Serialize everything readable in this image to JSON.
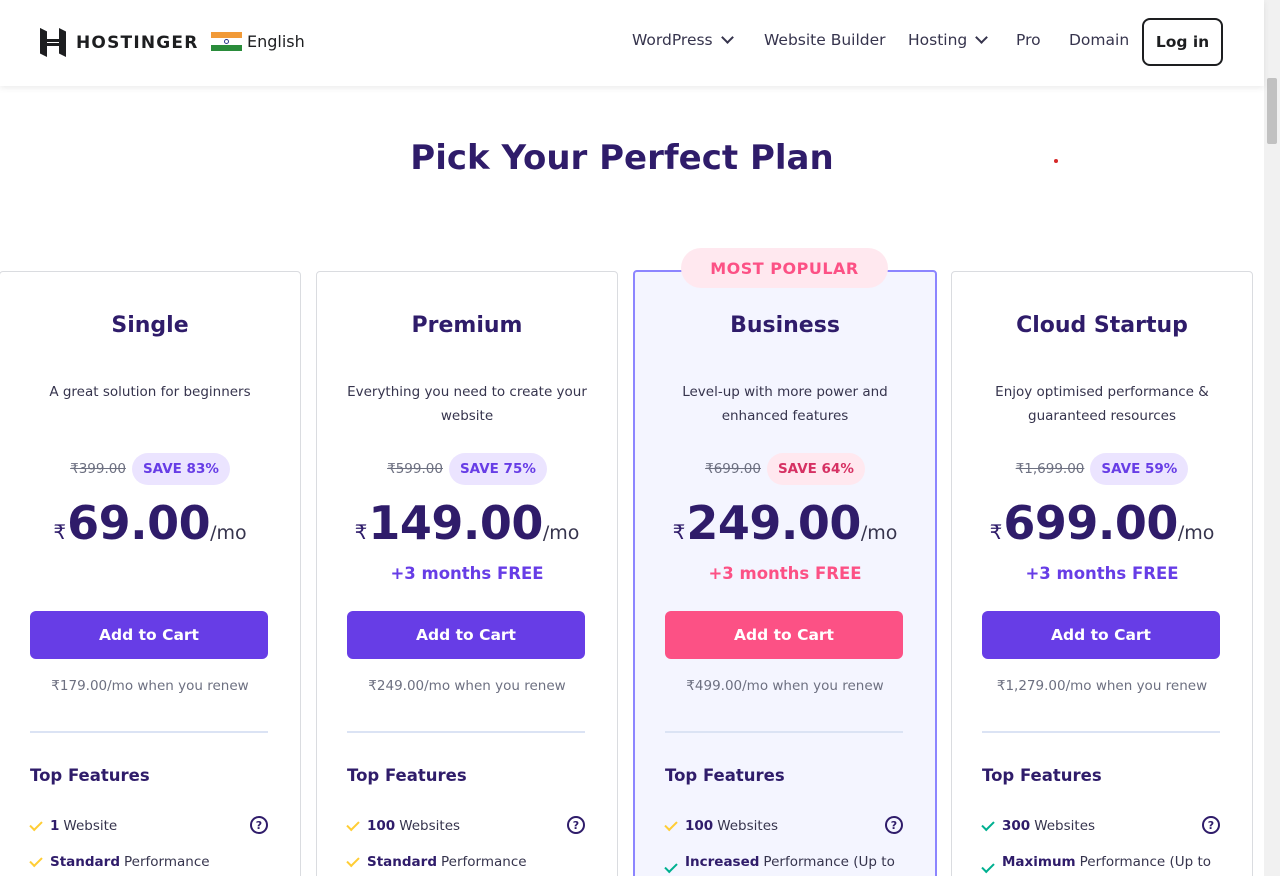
{
  "header": {
    "brand": "HOSTINGER",
    "language": "English",
    "nav": [
      {
        "label": "WordPress",
        "dropdown": true
      },
      {
        "label": "Website Builder",
        "dropdown": false
      },
      {
        "label": "Hosting",
        "dropdown": true
      },
      {
        "label": "Pro",
        "dropdown": false
      },
      {
        "label": "Domain",
        "dropdown": false
      }
    ],
    "login": "Log in"
  },
  "title": "Pick Your Perfect Plan",
  "popular_badge": "MOST POPULAR",
  "plans": [
    {
      "name": "Single",
      "description": "A great solution for beginners",
      "old_price": "₹399.00",
      "save": "SAVE 83%",
      "currency": "₹",
      "price": "69.00",
      "per": "/mo",
      "bonus": "",
      "cta": "Add to Cart",
      "renew": "₹179.00/mo when you renew",
      "features_title": "Top Features",
      "features": [
        {
          "bold": "1",
          "text": "Website"
        },
        {
          "bold": "Standard",
          "text": "Performance"
        }
      ]
    },
    {
      "name": "Premium",
      "description": "Everything you need to create your website",
      "old_price": "₹599.00",
      "save": "SAVE 75%",
      "currency": "₹",
      "price": "149.00",
      "per": "/mo",
      "bonus": "+3 months FREE",
      "cta": "Add to Cart",
      "renew": "₹249.00/mo when you renew",
      "features_title": "Top Features",
      "features": [
        {
          "bold": "100",
          "text": "Websites"
        },
        {
          "bold": "Standard",
          "text": "Performance"
        }
      ]
    },
    {
      "name": "Business",
      "description": "Level-up with more power and enhanced features",
      "old_price": "₹699.00",
      "save": "SAVE 64%",
      "currency": "₹",
      "price": "249.00",
      "per": "/mo",
      "bonus": "+3 months FREE",
      "cta": "Add to Cart",
      "renew": "₹499.00/mo when you renew",
      "features_title": "Top Features",
      "features": [
        {
          "bold": "100",
          "text": "Websites"
        },
        {
          "bold": "Increased",
          "text": "Performance (Up to"
        }
      ]
    },
    {
      "name": "Cloud Startup",
      "description": "Enjoy optimised performance & guaranteed resources",
      "old_price": "₹1,699.00",
      "save": "SAVE 59%",
      "currency": "₹",
      "price": "699.00",
      "per": "/mo",
      "bonus": "+3 months FREE",
      "cta": "Add to Cart",
      "renew": "₹1,279.00/mo when you renew",
      "features_title": "Top Features",
      "features": [
        {
          "bold": "300",
          "text": "Websites"
        },
        {
          "bold": "Maximum",
          "text": "Performance (Up to"
        }
      ]
    }
  ],
  "colors": {
    "accent": "#673de6",
    "highlight": "#fc5185",
    "heading": "#2f1c6a",
    "check_yellow": "#ffcd35",
    "check_green": "#00b090"
  },
  "icons": {
    "logo": "hostinger-logo-icon",
    "flag": "india-flag-icon",
    "dropdown": "chevron-down-icon",
    "check": "checkmark-icon",
    "help": "question-circle-icon"
  }
}
